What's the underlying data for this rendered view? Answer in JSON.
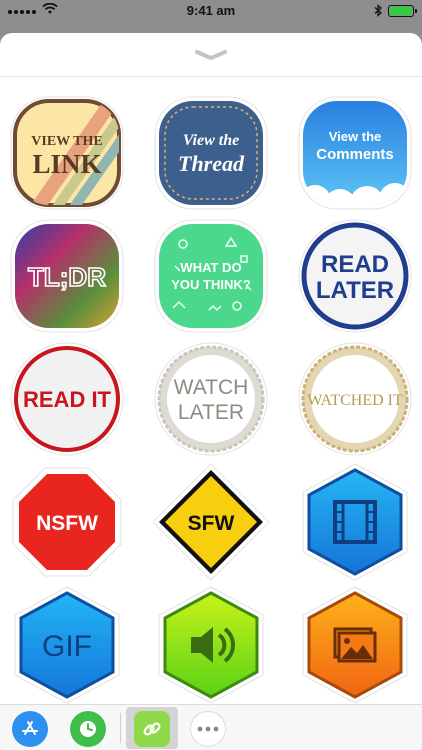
{
  "status": {
    "time": "9:41 am",
    "battery_color": "#2bd13a"
  },
  "grabber": {
    "icon": "chevron-down-icon"
  },
  "stickers": [
    {
      "id": "view-the-link",
      "lines": [
        "VIEW THE",
        "LINK"
      ]
    },
    {
      "id": "view-the-thread",
      "lines": [
        "View the",
        "Thread"
      ]
    },
    {
      "id": "view-the-comments",
      "lines": [
        "View the",
        "Comments"
      ]
    },
    {
      "id": "tldr",
      "lines": [
        "TL;DR"
      ]
    },
    {
      "id": "what-do-you-think",
      "lines": [
        "WHAT DO",
        "YOU THINK?"
      ]
    },
    {
      "id": "read-later",
      "lines": [
        "READ",
        "LATER"
      ]
    },
    {
      "id": "read-it",
      "lines": [
        "READ IT"
      ]
    },
    {
      "id": "watch-later",
      "lines": [
        "WATCH",
        "LATER"
      ]
    },
    {
      "id": "watched-it",
      "lines": [
        "WATCHED IT"
      ]
    },
    {
      "id": "nsfw",
      "lines": [
        "NSFW"
      ]
    },
    {
      "id": "sfw",
      "lines": [
        "SFW"
      ]
    },
    {
      "id": "film",
      "icon": "film-icon"
    },
    {
      "id": "gif",
      "lines": [
        "GIF"
      ]
    },
    {
      "id": "sound",
      "icon": "speaker-icon"
    },
    {
      "id": "picture",
      "icon": "picture-icon"
    }
  ],
  "dock": {
    "items": [
      {
        "id": "app-store",
        "icon": "app-store-icon"
      },
      {
        "id": "recents",
        "icon": "clock-icon"
      },
      {
        "id": "link-stickers",
        "icon": "link-icon",
        "selected": true
      },
      {
        "id": "more",
        "icon": "more-icon"
      }
    ]
  }
}
